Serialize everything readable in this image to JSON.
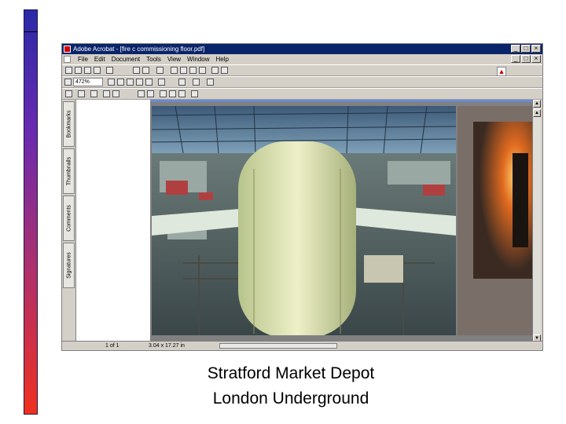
{
  "window": {
    "title": "Adobe Acrobat - [fire c commissioning floor.pdf]",
    "controls": [
      "_",
      "□",
      "×"
    ]
  },
  "menubar": {
    "items": [
      "File",
      "Edit",
      "Document",
      "Tools",
      "View",
      "Window",
      "Help"
    ]
  },
  "toolbar": {
    "zoom": "472%"
  },
  "navpane": {
    "tabs": [
      "Bookmarks",
      "Thumbnails",
      "Comments",
      "Signatures"
    ]
  },
  "statusbar": {
    "page": "1 of 1",
    "size": "3.04 x 17.27 in"
  },
  "slide": {
    "caption_line1": "Stratford Market Depot",
    "caption_line2": "London Underground"
  },
  "colors": {
    "titlebar": "#0a246a",
    "accent_gradient_top": "#2a2aa8",
    "accent_gradient_bottom": "#f03020"
  }
}
